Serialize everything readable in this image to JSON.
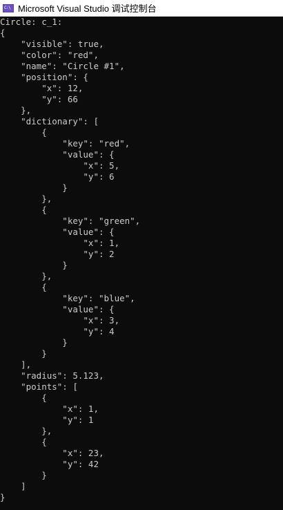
{
  "window": {
    "title": "Microsoft Visual Studio 调试控制台",
    "icon_text": "C:\\",
    "icon_name": "console-app-icon"
  },
  "console": {
    "lines": [
      "Circle: c_1:",
      "{",
      "    \"visible\": true,",
      "    \"color\": \"red\",",
      "    \"name\": \"Circle #1\",",
      "    \"position\": {",
      "        \"x\": 12,",
      "        \"y\": 66",
      "    },",
      "    \"dictionary\": [",
      "        {",
      "            \"key\": \"red\",",
      "            \"value\": {",
      "                \"x\": 5,",
      "                \"y\": 6",
      "            }",
      "        },",
      "        {",
      "            \"key\": \"green\",",
      "            \"value\": {",
      "                \"x\": 1,",
      "                \"y\": 2",
      "            }",
      "        },",
      "        {",
      "            \"key\": \"blue\",",
      "            \"value\": {",
      "                \"x\": 3,",
      "                \"y\": 4",
      "            }",
      "        }",
      "    ],",
      "    \"radius\": 5.123,",
      "    \"points\": [",
      "        {",
      "            \"x\": 1,",
      "            \"y\": 1",
      "        },",
      "        {",
      "            \"x\": 23,",
      "            \"y\": 42",
      "        }",
      "    ]",
      "}"
    ]
  },
  "colors": {
    "console_background": "#0c0c0c",
    "console_text": "#cccccc",
    "titlebar_background": "#ffffff"
  }
}
